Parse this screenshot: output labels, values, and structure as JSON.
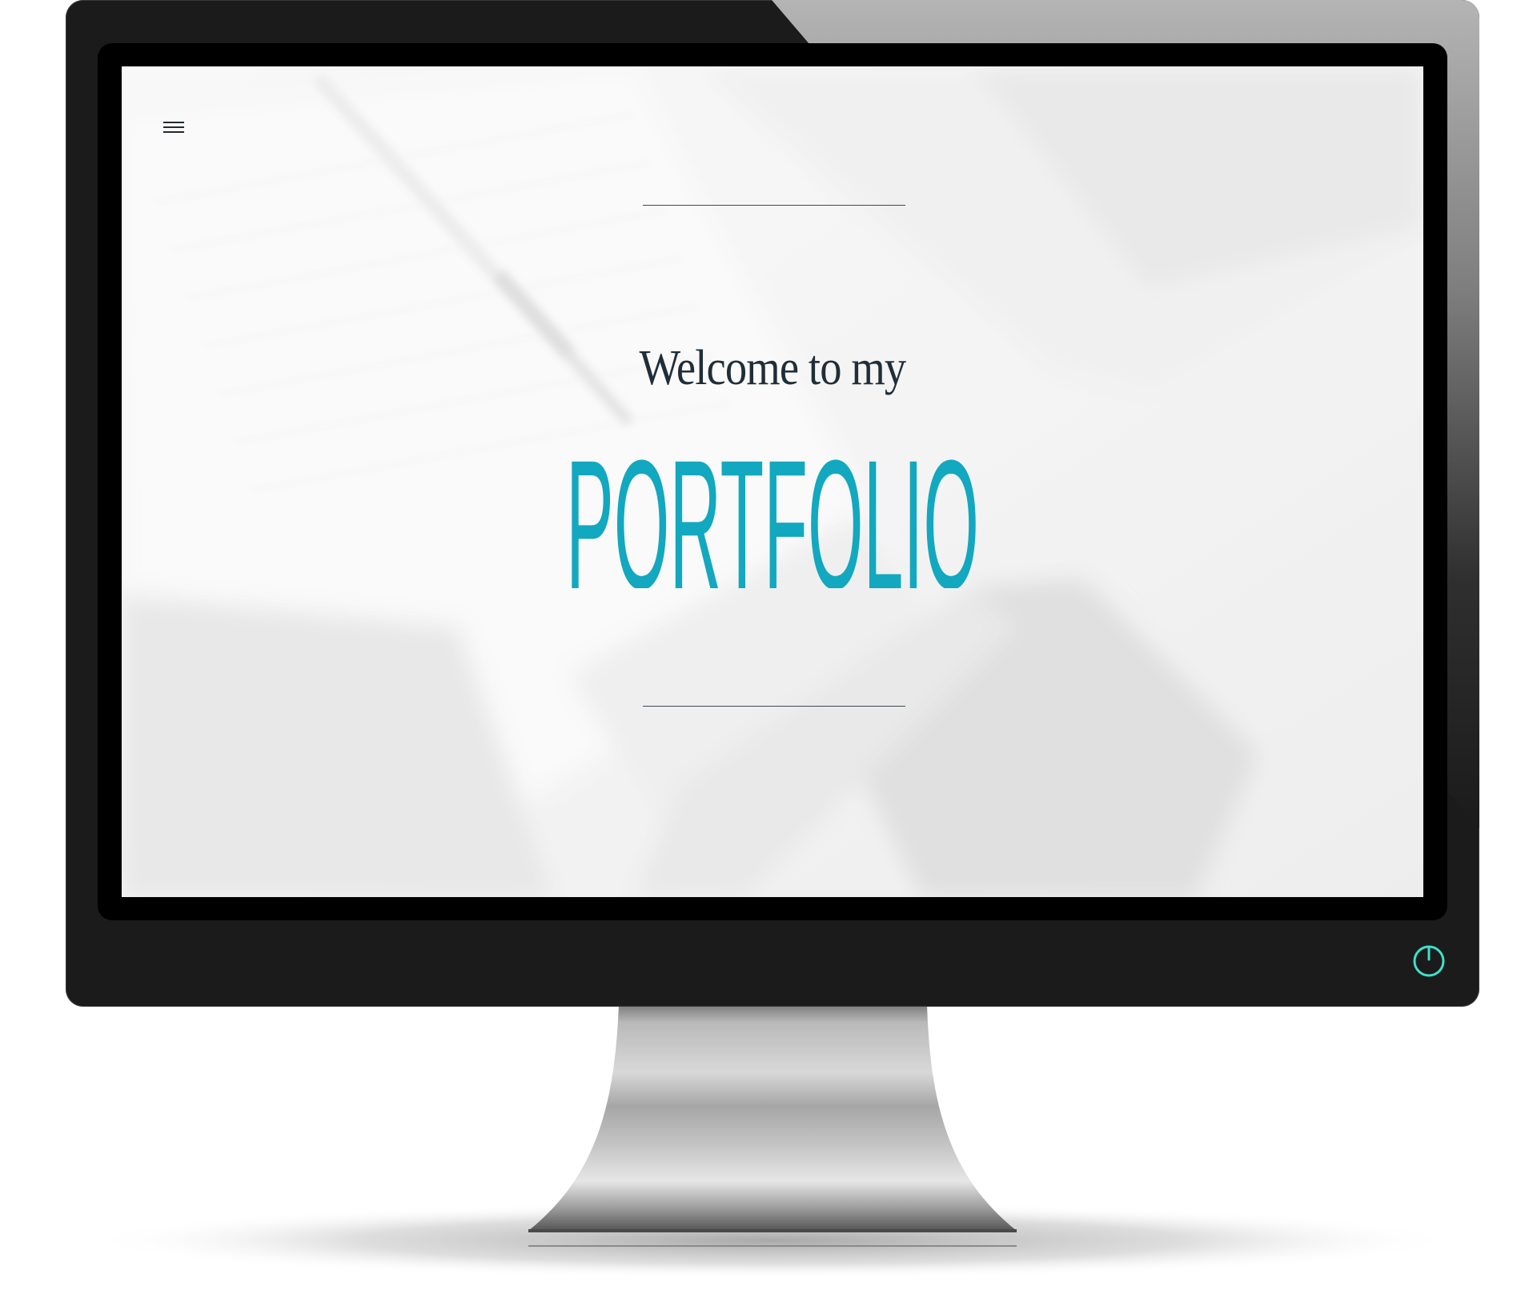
{
  "hero": {
    "welcome": "Welcome to my",
    "title": "PORTFOLIO"
  },
  "icons": {
    "menu": "hamburger-menu-icon",
    "power": "power-icon"
  },
  "colors": {
    "accent": "#12a8bf",
    "text_dark": "#1f2e38",
    "power_glow": "#3de0c8",
    "monitor": "#1b1b1b"
  }
}
